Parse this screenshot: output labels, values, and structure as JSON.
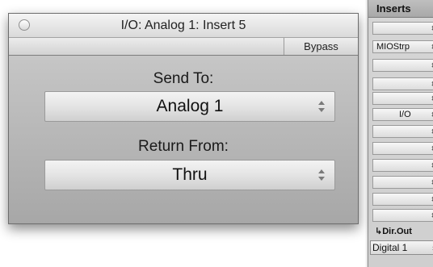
{
  "window": {
    "title": "I/O: Analog 1: Insert 5",
    "bypass_label": "Bypass",
    "send_label": "Send To:",
    "send_value": "Analog 1",
    "return_label": "Return From:",
    "return_value": "Thru"
  },
  "strip": {
    "header": "Inserts",
    "slots": [
      {
        "label": ""
      },
      {
        "label": "MIOStrp"
      },
      {
        "label": ""
      },
      {
        "label": ""
      },
      {
        "label": "I/O"
      },
      {
        "label": ""
      },
      {
        "label": ""
      },
      {
        "label": ""
      },
      {
        "label": ""
      },
      {
        "label": ""
      },
      {
        "label": ""
      }
    ],
    "dir_out_label": "↳Dir.Out",
    "dir_out_value": "Digital 1"
  },
  "colors": {
    "window_gradient_top": "#cfcfcf",
    "window_gradient_bottom": "#a7a7a7",
    "strip_bg": "#d3d3d3"
  }
}
